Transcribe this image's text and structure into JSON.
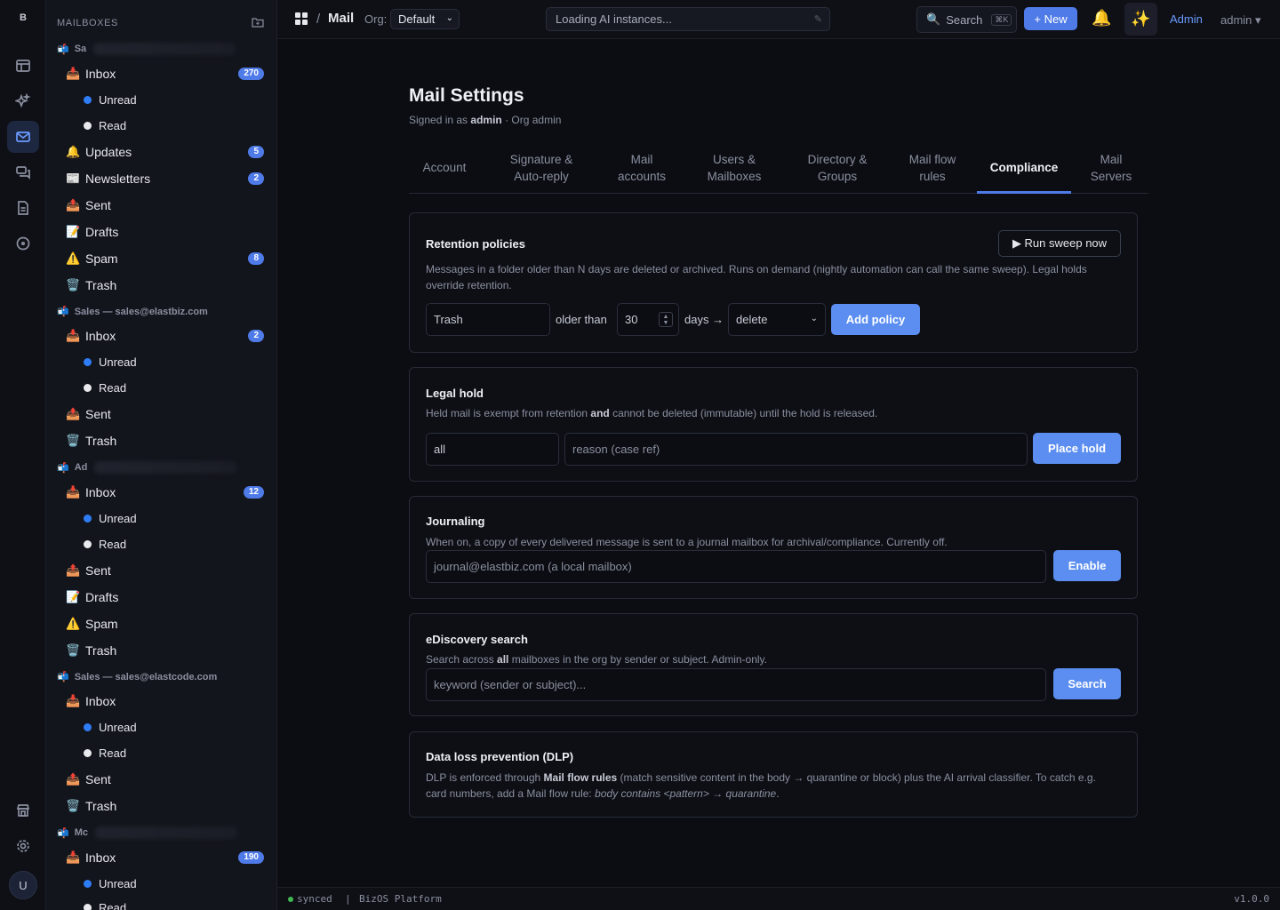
{
  "rail": {
    "logo": "B",
    "avatar": "U"
  },
  "sidebar": {
    "heading": "MAILBOXES",
    "accounts": [
      {
        "label": "Sa"
      },
      {
        "label": "Sales — sales@elastbiz.com"
      },
      {
        "label": "Ad"
      },
      {
        "label": "Sales — sales@elastcode.com"
      },
      {
        "label": "Mc"
      }
    ],
    "folders": {
      "inbox": "Inbox",
      "unread": "Unread",
      "read": "Read",
      "updates": "Updates",
      "newsletters": "Newsletters",
      "sent": "Sent",
      "drafts": "Drafts",
      "spam": "Spam",
      "trash": "Trash"
    },
    "badges": {
      "a1_inbox": "270",
      "a1_updates": "5",
      "a1_newsletters": "2",
      "a1_spam": "8",
      "a2_inbox": "2",
      "a3_inbox": "12",
      "a5_inbox": "190"
    }
  },
  "topbar": {
    "breadcrumb_sep": "/",
    "app": "Mail",
    "org_label": "Org:",
    "org_value": "Default",
    "ai_status": "Loading AI instances...",
    "search_label": "Search",
    "search_kbd": "⌘K",
    "new_label": "+ New",
    "admin_link": "Admin",
    "user_menu": "admin ▾"
  },
  "page": {
    "title": "Mail Settings",
    "signed_prefix": "Signed in as ",
    "signed_user": "admin",
    "signed_suffix": " · Org admin"
  },
  "tabs": [
    {
      "line1": "Account",
      "line2": ""
    },
    {
      "line1": "Signature &",
      "line2": "Auto-reply"
    },
    {
      "line1": "Mail",
      "line2": "accounts"
    },
    {
      "line1": "Users &",
      "line2": "Mailboxes"
    },
    {
      "line1": "Directory &",
      "line2": "Groups"
    },
    {
      "line1": "Mail flow",
      "line2": "rules"
    },
    {
      "line1": "Compliance",
      "line2": ""
    },
    {
      "line1": "Mail",
      "line2": "Servers"
    }
  ],
  "active_tab": "Compliance",
  "retention": {
    "title": "Retention policies",
    "run_label": "▶ Run sweep now",
    "desc": "Messages in a folder older than N days are deleted or archived. Runs on demand (nightly automation can call the same sweep). Legal holds override retention.",
    "folder_value": "Trash",
    "older_than": "older than",
    "days_value": "30",
    "days_label": "days →",
    "action_value": "delete",
    "add_label": "Add policy"
  },
  "legal_hold": {
    "title": "Legal hold",
    "desc_a": "Held mail is exempt from retention ",
    "desc_b": "and",
    "desc_c": " cannot be deleted (immutable) until the hold is released.",
    "scope_value": "all",
    "reason_placeholder": "reason (case ref)",
    "place_label": "Place hold"
  },
  "journaling": {
    "title": "Journaling",
    "desc": "When on, a copy of every delivered message is sent to a journal mailbox for archival/compliance. Currently off.",
    "mailbox_placeholder": "journal@elastbiz.com (a local mailbox)",
    "enable_label": "Enable"
  },
  "ediscovery": {
    "title": "eDiscovery search",
    "desc_a": "Search across ",
    "desc_b": "all",
    "desc_c": " mailboxes in the org by sender or subject. Admin-only.",
    "query_placeholder": "keyword (sender or subject)...",
    "search_label": "Search"
  },
  "dlp": {
    "title": "Data loss prevention (DLP)",
    "desc_a": "DLP is enforced through ",
    "desc_b": "Mail flow rules",
    "desc_c": " (match sensitive content in the body → quarantine or block) plus the AI arrival classifier. To catch e.g. card numbers, add a Mail flow rule: ",
    "desc_d": "body contains <pattern> → quarantine",
    "desc_e": "."
  },
  "status": {
    "state": "synced",
    "sep": "|",
    "platform": "BizOS Platform",
    "version": "v1.0.0"
  }
}
